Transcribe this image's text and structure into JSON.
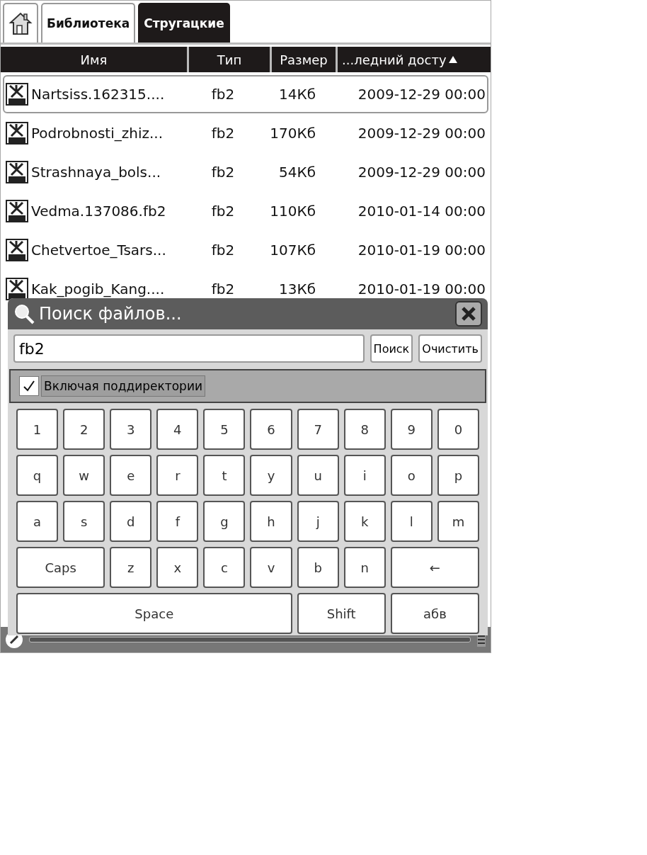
{
  "tabs": [
    {
      "label": "Библиотека",
      "selected": false
    },
    {
      "label": "Стругацкие",
      "selected": true
    }
  ],
  "table": {
    "columns": [
      {
        "label": "Имя",
        "sorted": false
      },
      {
        "label": "Тип",
        "sorted": false
      },
      {
        "label": "Размер",
        "sorted": false
      },
      {
        "label": "...ледний досту",
        "sorted": true
      }
    ],
    "rows": [
      {
        "name": "Nartsiss.162315....",
        "type": "fb2",
        "size": "14Кб",
        "date": "2009-12-29 00:00",
        "selected": true
      },
      {
        "name": "Podrobnosti_zhiz...",
        "type": "fb2",
        "size": "170Кб",
        "date": "2009-12-29 00:00",
        "selected": false
      },
      {
        "name": "Strashnaya_bols...",
        "type": "fb2",
        "size": "54Кб",
        "date": "2009-12-29 00:00",
        "selected": false
      },
      {
        "name": "Vedma.137086.fb2",
        "type": "fb2",
        "size": "110Кб",
        "date": "2010-01-14 00:00",
        "selected": false
      },
      {
        "name": "Chetvertoe_Tsars...",
        "type": "fb2",
        "size": "107Кб",
        "date": "2010-01-19 00:00",
        "selected": false
      },
      {
        "name": "Kak_pogib_Kang....",
        "type": "fb2",
        "size": "13Кб",
        "date": "2010-01-19 00:00",
        "selected": false
      }
    ]
  },
  "search_dialog": {
    "title": "Поиск файлов...",
    "value": "fb2",
    "buttons": [
      "Поиск",
      "Очистить"
    ],
    "include_subdirs": {
      "label": "Включая поддиректории",
      "checked": true
    },
    "keyboard": [
      [
        {
          "label": "1",
          "kind": "key"
        },
        {
          "label": "2",
          "kind": "key"
        },
        {
          "label": "3",
          "kind": "key"
        },
        {
          "label": "4",
          "kind": "key"
        },
        {
          "label": "5",
          "kind": "key"
        },
        {
          "label": "6",
          "kind": "key"
        },
        {
          "label": "7",
          "kind": "key"
        },
        {
          "label": "8",
          "kind": "key"
        },
        {
          "label": "9",
          "kind": "key"
        },
        {
          "label": "0",
          "kind": "key"
        }
      ],
      [
        {
          "label": "q",
          "kind": "key"
        },
        {
          "label": "w",
          "kind": "key"
        },
        {
          "label": "e",
          "kind": "key"
        },
        {
          "label": "r",
          "kind": "key"
        },
        {
          "label": "t",
          "kind": "key"
        },
        {
          "label": "y",
          "kind": "key"
        },
        {
          "label": "u",
          "kind": "key"
        },
        {
          "label": "i",
          "kind": "key"
        },
        {
          "label": "o",
          "kind": "key"
        },
        {
          "label": "p",
          "kind": "key"
        }
      ],
      [
        {
          "label": "a",
          "kind": "key"
        },
        {
          "label": "s",
          "kind": "key"
        },
        {
          "label": "d",
          "kind": "key"
        },
        {
          "label": "f",
          "kind": "key"
        },
        {
          "label": "g",
          "kind": "key"
        },
        {
          "label": "h",
          "kind": "key"
        },
        {
          "label": "j",
          "kind": "key"
        },
        {
          "label": "k",
          "kind": "key"
        },
        {
          "label": "l",
          "kind": "key"
        },
        {
          "label": "m",
          "kind": "key"
        }
      ],
      [
        {
          "label": "Caps",
          "kind": "wide"
        },
        {
          "label": "z",
          "kind": "key"
        },
        {
          "label": "x",
          "kind": "key"
        },
        {
          "label": "c",
          "kind": "key"
        },
        {
          "label": "v",
          "kind": "key"
        },
        {
          "label": "b",
          "kind": "key"
        },
        {
          "label": "n",
          "kind": "key"
        },
        {
          "label": "←",
          "kind": "wide"
        }
      ],
      [
        {
          "label": "Space",
          "kind": "space"
        },
        {
          "label": "Shift",
          "kind": "wide"
        },
        {
          "label": "абв",
          "kind": "wide"
        }
      ]
    ]
  }
}
